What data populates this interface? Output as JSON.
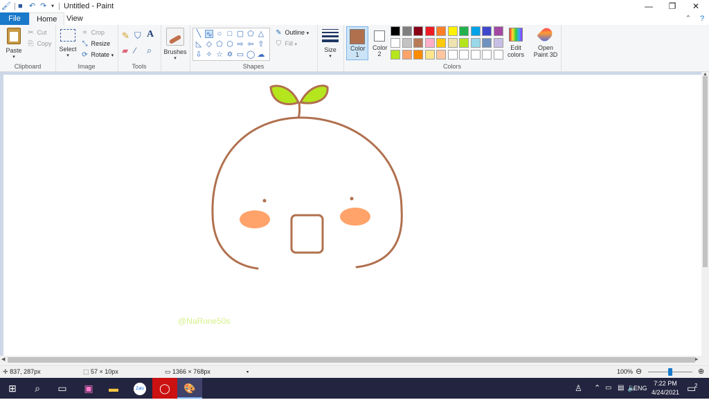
{
  "window": {
    "title": "Untitled - Paint",
    "quick_access": [
      "paint-app-icon",
      "save-icon",
      "undo-icon",
      "redo-icon",
      "customize-arrow"
    ]
  },
  "tabs": {
    "file": "File",
    "home": "Home",
    "view": "View"
  },
  "ribbon": {
    "clipboard": {
      "label": "Clipboard",
      "paste": "Paste",
      "cut": "Cut",
      "copy": "Copy"
    },
    "image": {
      "label": "Image",
      "select": "Select",
      "crop": "Crop",
      "resize": "Resize",
      "rotate": "Rotate"
    },
    "tools": {
      "label": "Tools"
    },
    "brushes": {
      "label": "Brushes"
    },
    "shapes": {
      "label": "Shapes",
      "outline": "Outline",
      "fill": "Fill"
    },
    "size": {
      "label": "Size"
    },
    "colors": {
      "label": "Colors",
      "color1": "Color 1",
      "color2": "Color 2",
      "color1_value": "#b0704e",
      "color2_value": "#ffffff",
      "edit": "Edit colors",
      "palette_row1": [
        "#000000",
        "#7f7f7f",
        "#880015",
        "#ed1c24",
        "#ff7f27",
        "#fff200",
        "#22b14c",
        "#00a2e8",
        "#3f48cc",
        "#a349a4"
      ],
      "palette_row2": [
        "#ffffff",
        "#c3c3c3",
        "#b97a57",
        "#ffaec9",
        "#ffc90e",
        "#efe4b0",
        "#b5e61d",
        "#99d9ea",
        "#7092be",
        "#c8bfe7"
      ],
      "palette_row3": [
        "#b5e61d",
        "#ffa36b",
        "#ff8c00",
        "#fce58c",
        "#ffc6a0",
        "#ffffff",
        "#ffffff",
        "#ffffff",
        "#ffffff",
        "#ffffff"
      ]
    },
    "paint3d": {
      "label": "Open Paint 3D"
    }
  },
  "canvas": {
    "watermark": "@NaRone50s"
  },
  "status": {
    "cursor": "837, 287px",
    "selection": "57 × 10px",
    "canvas_size": "1366 × 768px",
    "zoom": "100%"
  },
  "taskbar": {
    "language": "ENG",
    "time": "7:22 PM",
    "date": "4/24/2021",
    "notifications": "2"
  }
}
